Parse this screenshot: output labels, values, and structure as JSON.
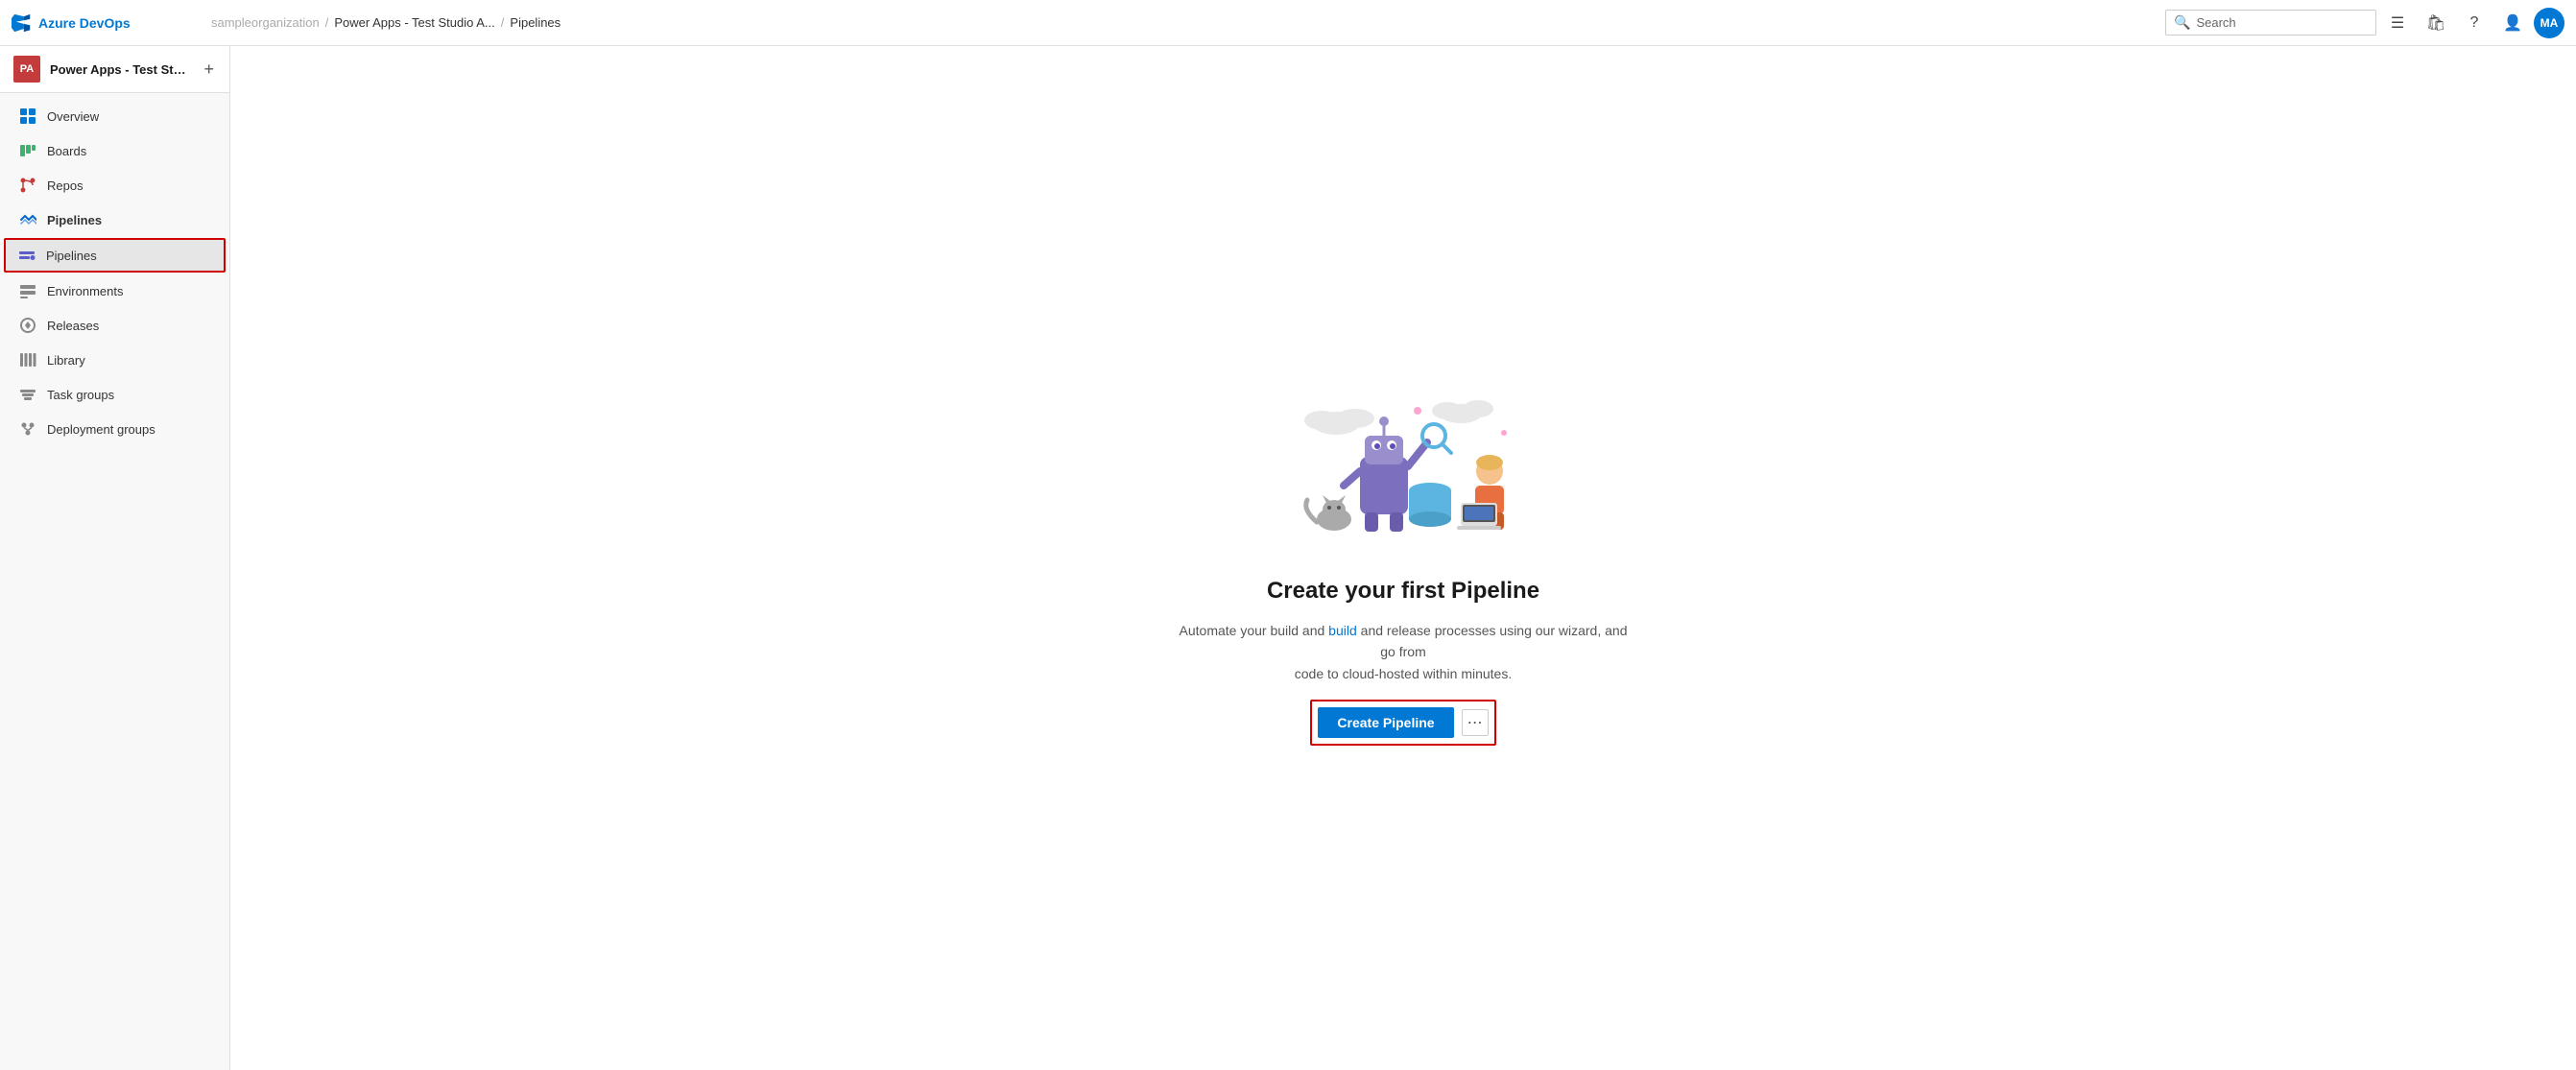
{
  "app": {
    "name": "Azure DevOps",
    "logo_letters": "AD"
  },
  "topbar": {
    "breadcrumb_org": "sampleorganization",
    "breadcrumb_project": "Power Apps - Test Studio A...",
    "breadcrumb_page": "Pipelines",
    "search_placeholder": "Search",
    "avatar_initials": "MA"
  },
  "sidebar": {
    "project_avatar": "PA",
    "project_name": "Power Apps - Test Stud...",
    "add_button_label": "+",
    "nav_items": [
      {
        "id": "overview",
        "label": "Overview",
        "icon": "overview"
      },
      {
        "id": "boards",
        "label": "Boards",
        "icon": "boards"
      },
      {
        "id": "repos",
        "label": "Repos",
        "icon": "repos"
      },
      {
        "id": "pipelines-parent",
        "label": "Pipelines",
        "icon": "pipelines",
        "is_parent": true
      },
      {
        "id": "pipelines",
        "label": "Pipelines",
        "icon": "pipelines-sub",
        "is_highlighted": true
      },
      {
        "id": "environments",
        "label": "Environments",
        "icon": "environments"
      },
      {
        "id": "releases",
        "label": "Releases",
        "icon": "releases"
      },
      {
        "id": "library",
        "label": "Library",
        "icon": "library"
      },
      {
        "id": "task-groups",
        "label": "Task groups",
        "icon": "task-groups"
      },
      {
        "id": "deployment-groups",
        "label": "Deployment groups",
        "icon": "deployment-groups"
      }
    ]
  },
  "main": {
    "title": "Create your first Pipeline",
    "description_part1": "Automate your build and ",
    "description_link1": "build",
    "description_part2": " and release processes using our wizard, and go from\ncode to cloud-hosted within minutes.",
    "description_full": "Automate your build and release processes using our wizard, and go from code to cloud-hosted within minutes.",
    "create_button_label": "Create Pipeline",
    "more_button_label": "⋯"
  }
}
